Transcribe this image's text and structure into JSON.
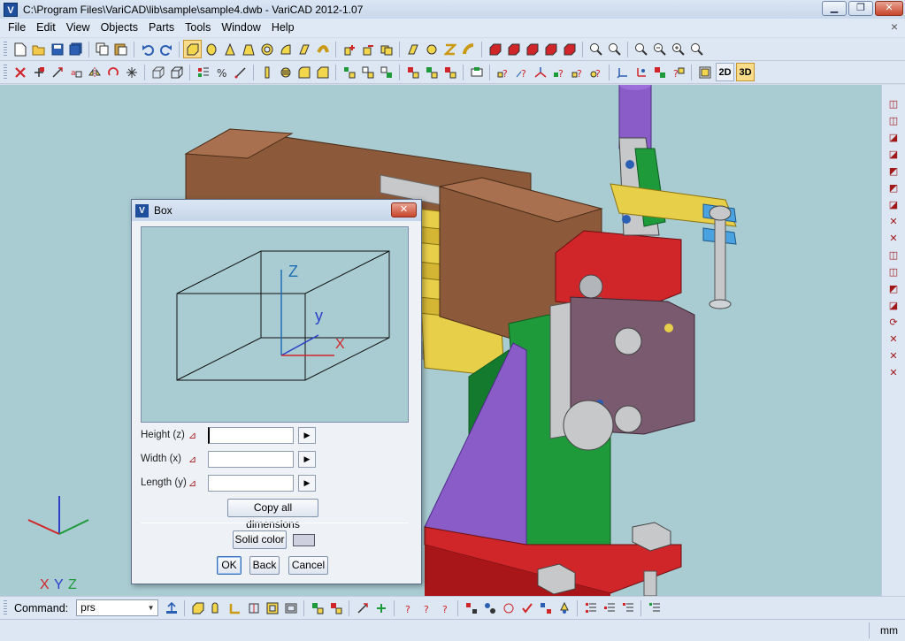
{
  "window": {
    "title": "C:\\Program Files\\VariCAD\\lib\\sample\\sample4.dwb - VariCAD 2012-1.07",
    "app_icon": "V",
    "minimize": "▁",
    "maximize": "❐",
    "close": "✕"
  },
  "menu": [
    "File",
    "Edit",
    "View",
    "Objects",
    "Parts",
    "Tools",
    "Window",
    "Help"
  ],
  "mdi_close": "×",
  "toolbar": {
    "view_2d": "2D",
    "view_3d": "3D"
  },
  "viewport": {
    "axis_labels": {
      "x": "X",
      "y": "Y",
      "z": "Z"
    },
    "background": "#a9ccd2"
  },
  "dialog": {
    "title": "Box",
    "close": "✕",
    "preview_axes": {
      "x": "X",
      "y": "y",
      "z": "Z"
    },
    "fields": [
      {
        "label": "Height (z)",
        "value": ""
      },
      {
        "label": "Width (x)",
        "value": ""
      },
      {
        "label": "Length (y)",
        "value": ""
      }
    ],
    "copy_all": "Copy all dimensions",
    "solid_color": "Solid color",
    "ok": "OK",
    "back": "Back",
    "cancel": "Cancel"
  },
  "command": {
    "label": "Command:",
    "value": "prs"
  },
  "status": {
    "unit": "mm"
  },
  "colors": {
    "chrome": "#dde6f3",
    "viewport_bg": "#a9ccd2",
    "part_brown": "#8c5a3a",
    "part_purple": "#8a5cc8",
    "part_green": "#1f9a3a",
    "part_red": "#d0262a",
    "part_yellow": "#e8cf4a"
  }
}
